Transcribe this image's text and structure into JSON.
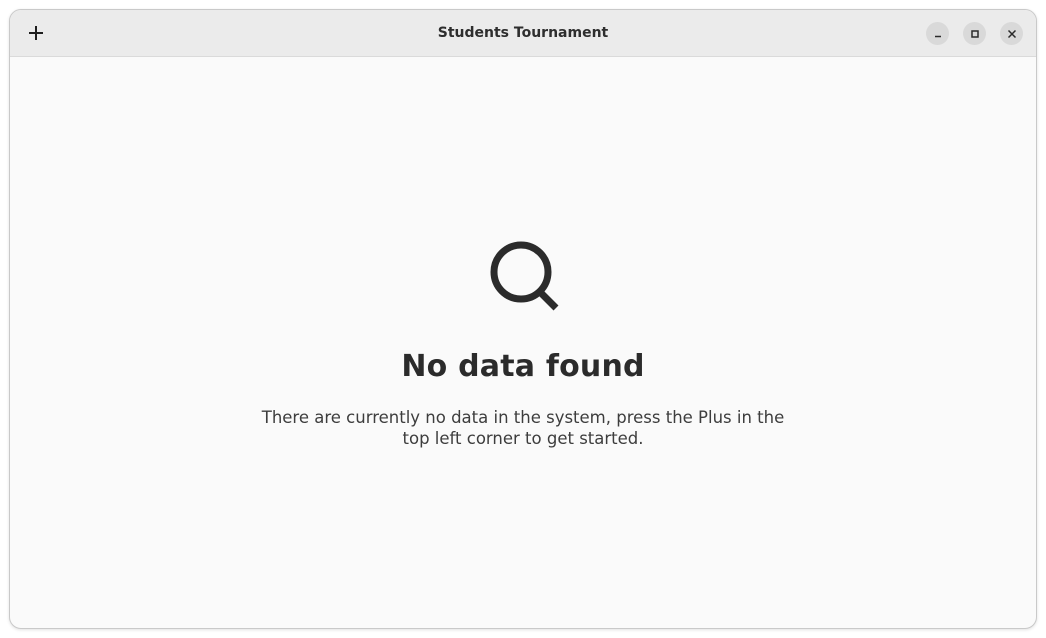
{
  "window": {
    "title": "Students Tournament"
  },
  "headerbar": {
    "add_icon": "plus-icon",
    "controls": [
      {
        "name": "minimize",
        "icon": "minimize-icon"
      },
      {
        "name": "maximize",
        "icon": "maximize-icon"
      },
      {
        "name": "close",
        "icon": "close-icon"
      }
    ]
  },
  "status_page": {
    "icon": "search-icon",
    "title": "No data found",
    "description": "There are currently no data in the system, press the Plus in the top left corner to get started."
  },
  "colors": {
    "headerbar_bg": "#ebebeb",
    "content_bg": "#fafafa",
    "control_bg": "#d9d9d9",
    "text": "#2b2b2b"
  }
}
